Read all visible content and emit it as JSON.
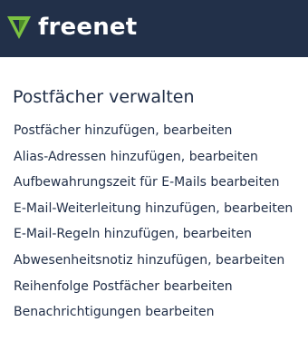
{
  "header": {
    "logo_text": "freenet",
    "logo_icon": "freenet-triangle-logo",
    "background_color": "#223049",
    "logo_accent_color": "#7cc242"
  },
  "main": {
    "title": "Postfächer verwalten",
    "text_color": "#223049",
    "menu_items": [
      {
        "label": "Postfächer hinzufügen, bearbeiten"
      },
      {
        "label": "Alias-Adressen hinzufügen, bearbeiten"
      },
      {
        "label": "Aufbewahrungszeit für E-Mails bearbeiten"
      },
      {
        "label": "E-Mail-Weiterleitung hinzufügen, bearbeiten"
      },
      {
        "label": "E-Mail-Regeln hinzufügen, bearbeiten"
      },
      {
        "label": "Abwesenheitsnotiz hinzufügen, bearbeiten"
      },
      {
        "label": "Reihenfolge Postfächer bearbeiten"
      },
      {
        "label": "Benachrichtigungen bearbeiten"
      }
    ]
  }
}
